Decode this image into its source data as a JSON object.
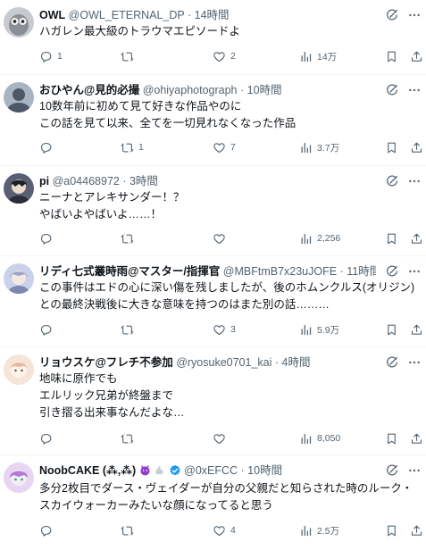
{
  "replies": [
    {
      "name": "OWL",
      "handle": "@OWL_ETERNAL_DP",
      "time": "· 14時間",
      "text": "ハガレン最大級のトラウマエピソードよ",
      "reply_count": "1",
      "retweet_count": "",
      "like_count": "2",
      "view_count": "14万",
      "avatar_color": "#8a8f96"
    },
    {
      "name": "おひやん@見的必撮",
      "handle": "@ohiyaphotograph",
      "time": "· 10時間",
      "text": "10数年前に初めて見て好きな作品やのに\nこの話を見て以来、全てを一切見れなくなった作品",
      "reply_count": "",
      "retweet_count": "1",
      "like_count": "7",
      "view_count": "3.7万",
      "avatar_color": "#4a5868"
    },
    {
      "name": "pi",
      "handle": "@a04468972",
      "time": "· 3時間",
      "text": "ニーナとアレキサンダー！？\nやばいよやばいよ……！",
      "reply_count": "",
      "retweet_count": "",
      "like_count": "",
      "view_count": "2,256",
      "avatar_color": "#2b2d3a"
    },
    {
      "name": "リディ七式叢時雨@マスター/指揮官",
      "handle": "@MBFtmB7x23uJOFE",
      "time": "· 11時間",
      "text": "この事件はエドの心に深い傷を残しましたが、後のホムンクルス(オリジン)\nとの最終決戦後に大きな意味を持つのはまた別の話………",
      "reply_count": "",
      "retweet_count": "",
      "like_count": "3",
      "view_count": "5.9万",
      "avatar_color": "#9aa6c8"
    },
    {
      "name": "リョウスケ@フレチ不参加",
      "handle": "@ryosuke0701_kai",
      "time": "· 4時間",
      "text": "地味に原作でも\nエルリック兄弟が終盤まで\n引き摺る出来事なんだよな…",
      "reply_count": "",
      "retweet_count": "",
      "like_count": "",
      "view_count": "8,050",
      "avatar_color": "#e8b9a0"
    },
    {
      "name": "NoobCAKE (⁂,⁂)",
      "handle": "@0xEFCC",
      "time": "· 10時間",
      "text": "多分2枚目でダース・ヴェイダーが自分の父親だと知らされた時のルーク・\nスカイウォーカーみたいな顔になってると思う",
      "reply_count": "",
      "retweet_count": "",
      "like_count": "4",
      "view_count": "2.5万",
      "avatar_color": "#b07ad8"
    }
  ],
  "colors": {
    "text": "#0f1419",
    "muted": "#536471",
    "verified": "#1d9bf0",
    "divider": "#eff3f4"
  },
  "icons": [
    "reply-icon",
    "retweet-icon",
    "like-icon",
    "views-icon",
    "bookmark-icon",
    "share-icon",
    "grok-icon",
    "more-icon",
    "verified-badge-icon"
  ]
}
